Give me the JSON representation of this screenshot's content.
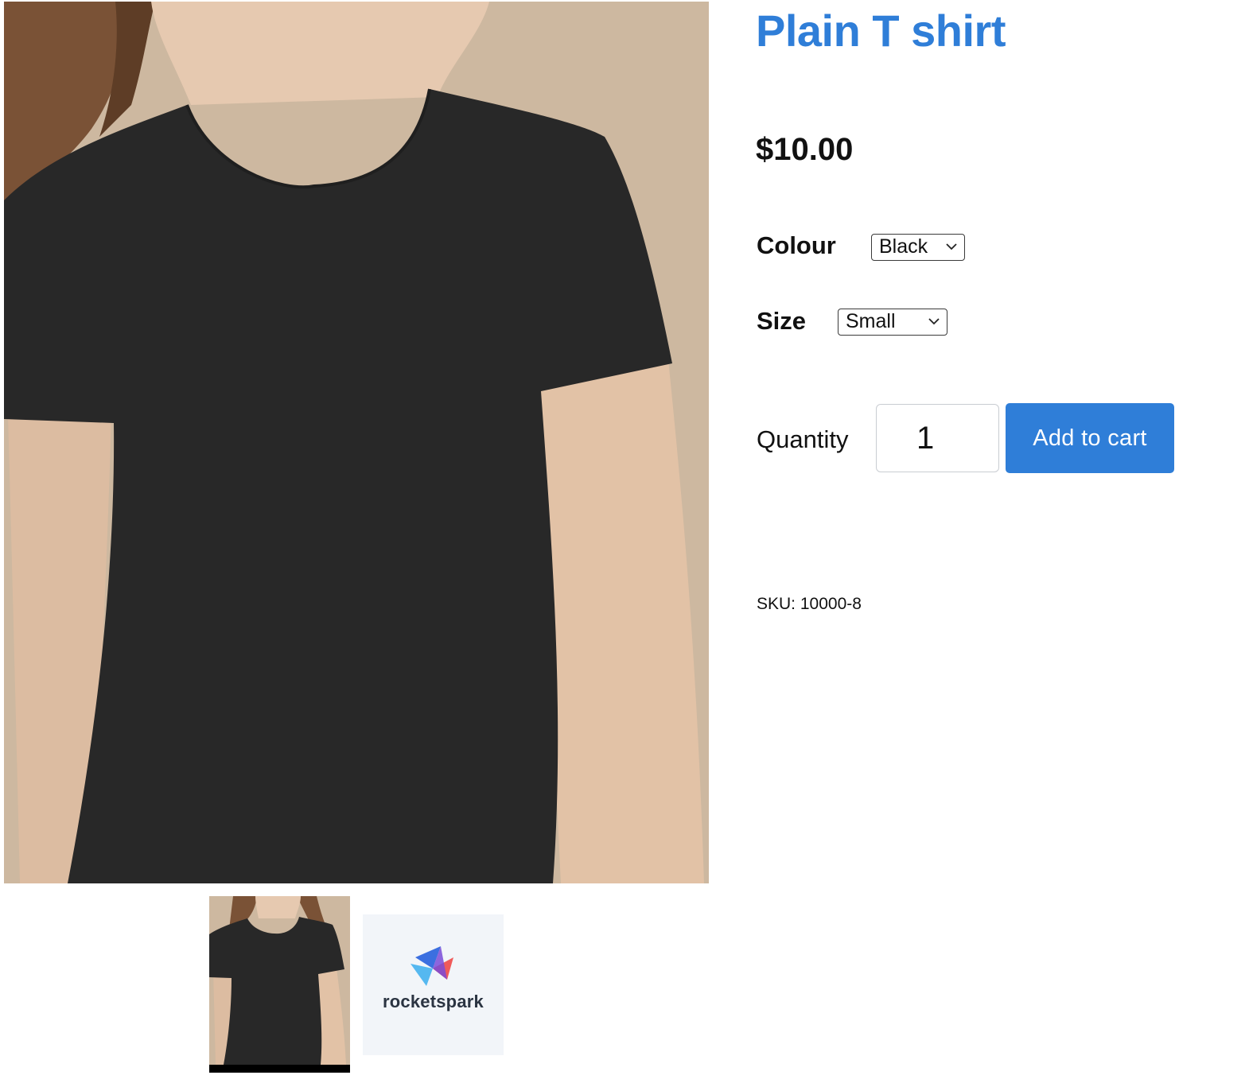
{
  "product": {
    "title": "Plain T shirt",
    "price": "$10.00",
    "sku": "SKU: 10000-8"
  },
  "options": {
    "colour": {
      "label": "Colour",
      "selected": "Black"
    },
    "size": {
      "label": "Size",
      "selected": "Small"
    }
  },
  "cart": {
    "quantity_label": "Quantity",
    "quantity_value": "1",
    "add_button": "Add to cart"
  },
  "gallery": {
    "thumbnails": [
      {
        "kind": "product-photo",
        "active": true
      },
      {
        "kind": "brand-logo",
        "logo_text": "rocketspark",
        "active": false
      }
    ]
  },
  "colors": {
    "accent": "#2f7ed8",
    "shirt": "#282828",
    "backdrop": "#cdb8a0",
    "skin": "#e6c9b0"
  },
  "icons": {
    "select_arrow": "chevron-down-icon",
    "logo": "rocketspark-logo-icon"
  }
}
